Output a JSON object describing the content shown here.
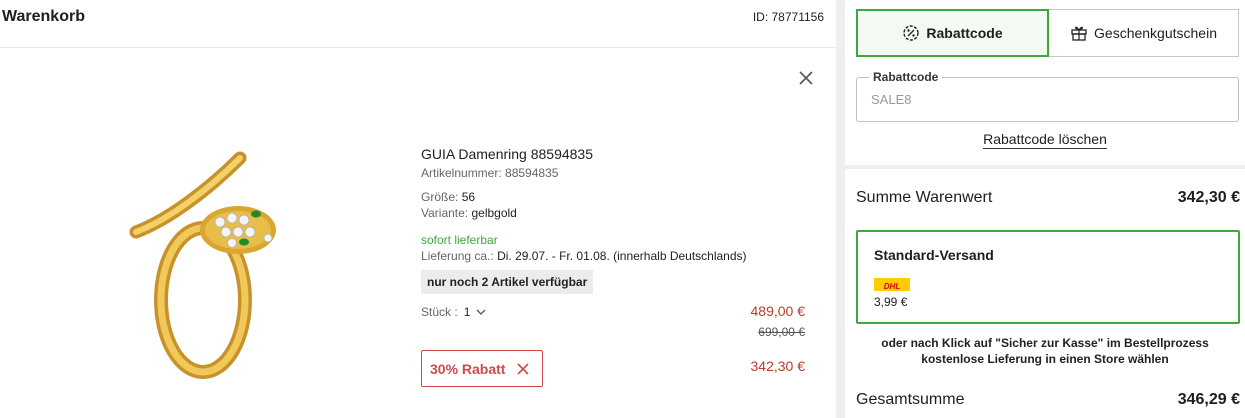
{
  "cart": {
    "title": "Warenkorb",
    "id_text": "ID: 78771156"
  },
  "product": {
    "image_alt": "Goldener Schlangenring",
    "name": "GUIA Damenring 88594835",
    "article_label": "Artikelnummer:",
    "article_value": "88594835",
    "size_label": "Größe:",
    "size_value": "56",
    "variant_label": "Variante:",
    "variant_value": "gelbgold",
    "availability": "sofort lieferbar",
    "delivery_label": "Lieferung ca.:",
    "delivery_value": "Di. 29.07. - Fr. 01.08. (innerhalb Deutschlands)",
    "stock_badge": "nur noch 2 Artikel verfügbar",
    "qty_label": "Stück :",
    "qty_value": "1",
    "price_now": "489,00 €",
    "price_old": "699,00 €",
    "discount_label": "30% Rabatt",
    "price_final": "342,30 €"
  },
  "voucher": {
    "tab_discount": "Rabattcode",
    "tab_giftcard": "Geschenkgutschein",
    "field_label": "Rabattcode",
    "field_value": "SALE8",
    "delete_label": "Rabattcode löschen"
  },
  "summary": {
    "goods_label": "Summe Warenwert",
    "goods_value": "342,30 €",
    "shipping_title": "Standard-Versand",
    "carrier_logo_text": "DHL",
    "shipping_price": "3,99  €",
    "note_line1": "oder nach Klick auf \"Sicher zur Kasse\" im Bestellprozess",
    "note_line2": "kostenlose Lieferung in einen Store wählen",
    "total_label": "Gesamtsumme",
    "total_value": "346,29 €"
  },
  "colors": {
    "accent_green": "#3ea83e",
    "price_red": "#c0392b",
    "discount_red": "#d04a4a",
    "gold": "#d9a62e",
    "dhl_yellow": "#ffcc00"
  }
}
